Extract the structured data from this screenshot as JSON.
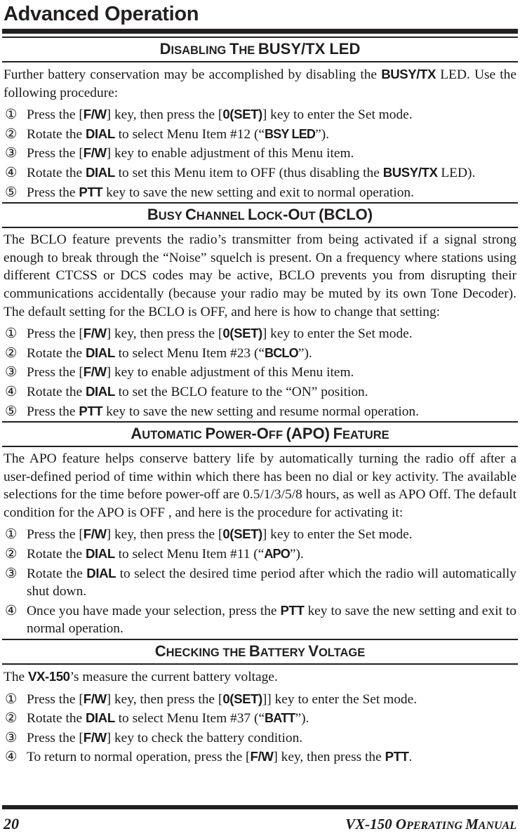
{
  "header": {
    "running_title": "Advanced Operation"
  },
  "sections": [
    {
      "id": "disabling-busy-tx-led",
      "heading_parts": [
        {
          "t": "D",
          "size": "cap"
        },
        {
          "t": "ISABLING",
          "size": "sm"
        },
        {
          "t": " ",
          "size": "sm"
        },
        {
          "t": "T",
          "size": "cap"
        },
        {
          "t": "HE",
          "size": "sm"
        },
        {
          "t": " ",
          "size": "sm"
        },
        {
          "t": "BUSY/TX LED",
          "size": "big"
        }
      ],
      "heading_text": "DISABLING THE BUSY/TX LED",
      "intro": "Further battery conservation may be accomplished by disabling the BUSY/TX LED. Use the following procedure:",
      "steps": [
        "Press the [F/W] key, then press the [0(SET)] key to enter the Set mode.",
        "Rotate the DIAL to select Menu Item #12 (“BSY LED”).",
        "Press the [F/W] key to enable adjustment of this Menu item.",
        "Rotate the DIAL to set this Menu item to OFF (thus disabling the BUSY/TX LED).",
        "Press the PTT key to save the new setting and exit to normal operation."
      ]
    },
    {
      "id": "busy-channel-lock-out",
      "heading_parts": [
        {
          "t": "B",
          "size": "cap"
        },
        {
          "t": "USY",
          "size": "sm"
        },
        {
          "t": " ",
          "size": "sm"
        },
        {
          "t": "C",
          "size": "cap"
        },
        {
          "t": "HANNEL",
          "size": "sm"
        },
        {
          "t": " ",
          "size": "sm"
        },
        {
          "t": "L",
          "size": "cap"
        },
        {
          "t": "OCK",
          "size": "sm"
        },
        {
          "t": "-",
          "size": "cap"
        },
        {
          "t": "O",
          "size": "cap"
        },
        {
          "t": "UT",
          "size": "sm"
        },
        {
          "t": " ",
          "size": "sm"
        },
        {
          "t": "(BCLO)",
          "size": "big"
        }
      ],
      "heading_text": "BUSY CHANNEL LOCK-OUT (BCLO)",
      "intro": "The BCLO feature prevents the radio’s transmitter from being activated if a signal strong enough to break through the “Noise” squelch is present. On a frequency where stations using different CTCSS or DCS codes may be active, BCLO prevents you from disrupting their communications accidentally (because your radio may be muted by its own Tone Decoder). The default setting for the BCLO is OFF, and here is how to change that setting:",
      "steps": [
        "Press the [F/W] key, then press the [0(SET)] key to enter the Set mode.",
        "Rotate the DIAL to select Menu Item #23 (“BCLO”).",
        "Press the [F/W] key to enable adjustment of this Menu item.",
        "Rotate the DIAL to set the BCLO feature to the “ON” position.",
        "Press the PTT key to save the new setting and resume normal operation."
      ]
    },
    {
      "id": "automatic-power-off-apo-feature",
      "heading_parts": [
        {
          "t": "A",
          "size": "cap"
        },
        {
          "t": "UTOMATIC",
          "size": "sm"
        },
        {
          "t": " ",
          "size": "sm"
        },
        {
          "t": "P",
          "size": "cap"
        },
        {
          "t": "OWER",
          "size": "sm"
        },
        {
          "t": "-",
          "size": "cap"
        },
        {
          "t": "O",
          "size": "cap"
        },
        {
          "t": "FF",
          "size": "sm"
        },
        {
          "t": " ",
          "size": "sm"
        },
        {
          "t": "(APO)",
          "size": "big"
        },
        {
          "t": " ",
          "size": "sm"
        },
        {
          "t": "F",
          "size": "cap"
        },
        {
          "t": "EATURE",
          "size": "sm"
        }
      ],
      "heading_text": "AUTOMATIC POWER-OFF (APO) FEATURE",
      "intro": "The APO feature helps conserve battery life by automatically turning the radio off after a user-defined period of time within which there has been no dial or key activity. The available selections for the time before power-off are 0.5/1/3/5/8 hours, as well as APO Off. The default condition for the APO is OFF , and here is the procedure for activating it:",
      "steps": [
        "Press the [F/W] key, then press the [0(SET)] key to enter the Set mode.",
        "Rotate the DIAL to select Menu Item #11 (“APO”).",
        "Rotate the DIAL to select the desired time period after which the radio will automatically shut down.",
        "Once you have made your selection, press the PTT key to save the new setting and exit to normal operation."
      ]
    },
    {
      "id": "checking-the-battery-voltage",
      "heading_parts": [
        {
          "t": "C",
          "size": "cap"
        },
        {
          "t": "HECKING",
          "size": "sm"
        },
        {
          "t": " ",
          "size": "sm"
        },
        {
          "t": "THE",
          "size": "sm"
        },
        {
          "t": " ",
          "size": "sm"
        },
        {
          "t": "B",
          "size": "cap"
        },
        {
          "t": "ATTERY",
          "size": "sm"
        },
        {
          "t": " ",
          "size": "sm"
        },
        {
          "t": "V",
          "size": "cap"
        },
        {
          "t": "OLTAGE",
          "size": "sm"
        }
      ],
      "heading_text": "CHECKING THE BATTERY VOLTAGE",
      "intro": "The VX-150’s measure the current battery voltage.",
      "steps": [
        "Press the [F/W] key, then press the [0(SET)]] key to enter the Set mode.",
        "Rotate the DIAL to select Menu Item #37 (“BATT”).",
        "Press the [F/W] key to check the battery condition.",
        "To return to normal operation, press the [F/W] key, then press the PTT."
      ]
    }
  ],
  "step_markers": [
    "①",
    "②",
    "③",
    "④",
    "⑤"
  ],
  "footer": {
    "page_number": "20",
    "manual_title": "VX-150 OPERATING MANUAL",
    "manual_parts": [
      {
        "t": "VX-150 ",
        "size": "big"
      },
      {
        "t": "O",
        "size": "big"
      },
      {
        "t": "PERATING",
        "size": "sm"
      },
      {
        "t": " ",
        "size": "sm"
      },
      {
        "t": "M",
        "size": "big"
      },
      {
        "t": "ANUAL",
        "size": "sm"
      }
    ]
  },
  "menu_items": {
    "bsy_led": {
      "number": "#12",
      "label": "BSY LED"
    },
    "bclo": {
      "number": "#23",
      "label": "BCLO"
    },
    "apo": {
      "number": "#11",
      "label": "APO"
    },
    "batt": {
      "number": "#37",
      "label": "BATT"
    }
  },
  "colors": {
    "ink": "#1a1a1a",
    "rule": "#231f20",
    "paper": "#ffffff"
  }
}
